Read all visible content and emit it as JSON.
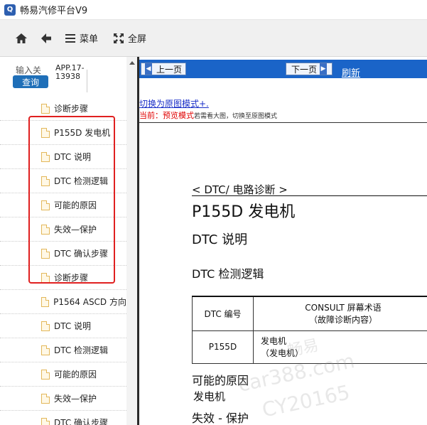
{
  "window": {
    "title": "畅易汽修平台V9",
    "icon_name": "app-logo-icon"
  },
  "toolbar": {
    "home_icon": "home-icon",
    "back_icon": "back-arrow-icon",
    "menu_icon": "menu-icon",
    "menu_label": "菜单",
    "fullscreen_icon": "fullscreen-icon",
    "fullscreen_label": "全屏"
  },
  "sidebar": {
    "search_placeholder": "输入关",
    "query_label": "查询",
    "app_code": "APP.17-13938",
    "highlight_color": "#e02020",
    "items": [
      {
        "label": "诊断步骤"
      },
      {
        "label": "P155D 发电机"
      },
      {
        "label": "DTC 说明"
      },
      {
        "label": "DTC 检测逻辑"
      },
      {
        "label": "可能的原因"
      },
      {
        "label": "失效—保护"
      },
      {
        "label": "DTC 确认步骤"
      },
      {
        "label": "诊断步骤"
      },
      {
        "label": "P1564 ASCD 方向"
      },
      {
        "label": "DTC 说明"
      },
      {
        "label": "DTC 检测逻辑"
      },
      {
        "label": "可能的原因"
      },
      {
        "label": "失效—保护"
      },
      {
        "label": "DTC 确认步骤"
      }
    ]
  },
  "content": {
    "prev_label": "上一页",
    "next_label": "下一页",
    "refresh_label": "刷新",
    "nav_color": "#1a64c8",
    "mode_link": "切换为原图模式+.",
    "mode_status_prefix": "当前：预览模式",
    "mode_status_hint": "若需看大图，切换至原图模式",
    "section_heading": "< DTC/ 电路诊断 >",
    "title": "P155D 发电机",
    "dtc_desc": "DTC 说明",
    "detect_logic": "DTC 检测逻辑",
    "table": {
      "col1_header": "DTC 编号",
      "col2_header_line1": "CONSULT 屏幕术语",
      "col2_header_line2": "（故障诊断内容）",
      "row_code": "P155D",
      "row_term_line1": "发电机",
      "row_term_line2": "（发电机）"
    },
    "possible_cause": "可能的原因",
    "generator": "发电机",
    "fail_safe": "失效 - 保护",
    "watermark_1": "畅易",
    "watermark_2": "car388.com",
    "watermark_3": "CY20165"
  }
}
